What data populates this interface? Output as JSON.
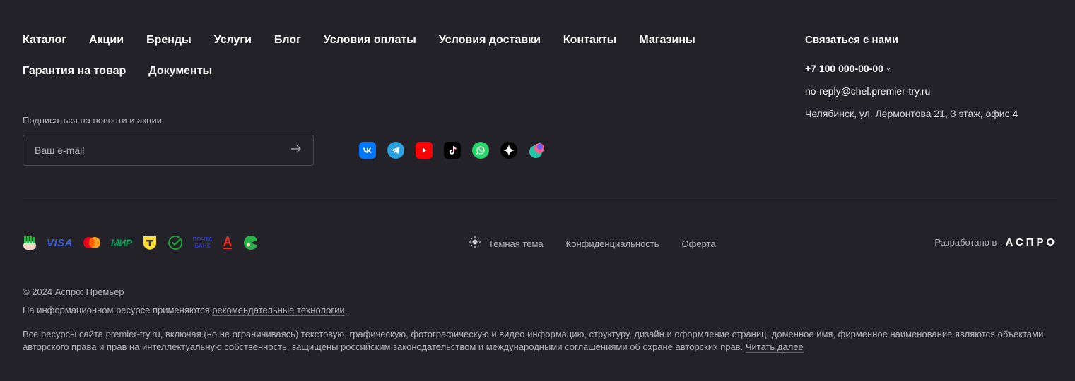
{
  "nav": {
    "row1": [
      "Каталог",
      "Акции",
      "Бренды",
      "Услуги",
      "Блог",
      "Условия оплаты",
      "Условия доставки",
      "Контакты",
      "Магазины"
    ],
    "row2": [
      "Гарантия на товар",
      "Документы"
    ]
  },
  "contact": {
    "title": "Связаться с нами",
    "phone": "+7 100 000-00-00",
    "email": "no-reply@chel.premier-try.ru",
    "address": "Челябинск, ул. Лермонтова 21, 3 этаж, офис 4"
  },
  "subscribe": {
    "label": "Подписаться на новости и акции",
    "placeholder": "Ваш e-mail"
  },
  "socials": [
    "vk-icon",
    "telegram-icon",
    "youtube-icon",
    "tiktok-icon",
    "whatsapp-icon",
    "dzen-icon",
    "odnoklassniki-icon"
  ],
  "payments": [
    "sbp-icon",
    "visa-icon",
    "mastercard-icon",
    "mir-icon",
    "tinkoff-icon",
    "sber-icon",
    "pochta-bank-icon",
    "alfa-bank-icon",
    "bank-icon"
  ],
  "payment_labels": {
    "visa": "VISA",
    "mir": "МИР",
    "pochta_line1": "ПОЧТА",
    "pochta_line2": "БАНК"
  },
  "bottom": {
    "theme_label": "Темная тема",
    "privacy": "Конфиденциальность",
    "offer": "Оферта",
    "dev_text": "Разработано в",
    "dev_logo": "АСПРО"
  },
  "legal": {
    "copyright": "© 2024 Аспро: Премьер",
    "rec_prefix": "На информационном ресурсе применяются ",
    "rec_link": "рекомендательные технологии",
    "rec_suffix": ".",
    "text": "Все ресурсы сайта premier-try.ru, включая (но не ограничиваясь) текстовую, графическую, фотографическую и видео информацию, структуру, дизайн и оформление страниц, доменное имя, фирменное наименование являются объектами авторского права и прав на интеллектуальную собственность, защищены российским законодательством и международными соглашениями об охране авторских прав. ",
    "read_more": "Читать далее"
  },
  "colors": {
    "background": "#232228",
    "text": "#ffffff",
    "muted": "#b4b4ba"
  }
}
